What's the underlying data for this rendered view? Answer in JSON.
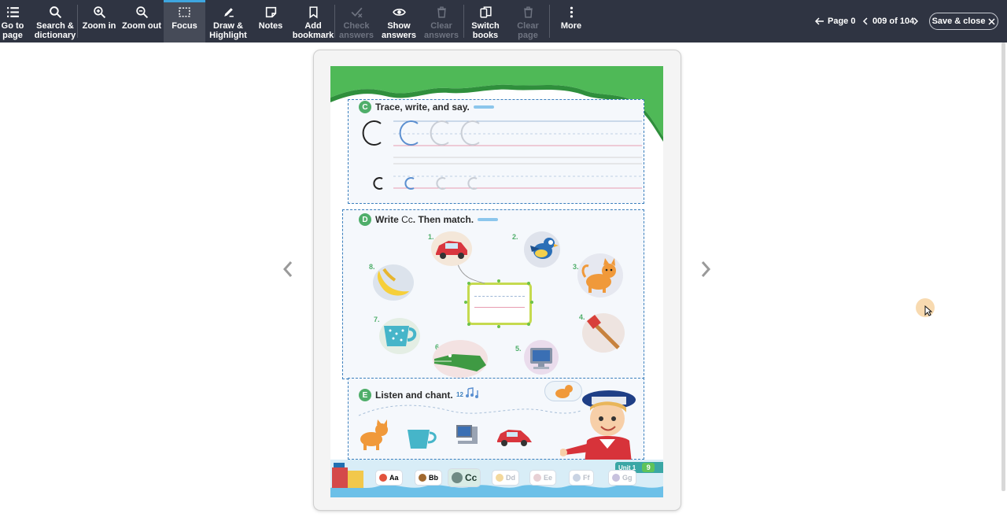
{
  "toolbar": {
    "buttons": [
      {
        "label": "Go to\npage",
        "icon": "toc-icon",
        "disabled": false
      },
      {
        "label": "Search &\ndictionary",
        "icon": "search-icon",
        "disabled": false
      },
      {
        "label": "Zoom in",
        "icon": "zoom-in-icon",
        "disabled": false
      },
      {
        "label": "Zoom out",
        "icon": "zoom-out-icon",
        "disabled": false
      },
      {
        "label": "Focus",
        "icon": "focus-icon",
        "disabled": false,
        "active": true
      },
      {
        "label": "Draw &\nHighlight",
        "icon": "pen-icon",
        "disabled": false
      },
      {
        "label": "Notes",
        "icon": "note-icon",
        "disabled": false
      },
      {
        "label": "Add\nbookmark",
        "icon": "bookmark-icon",
        "disabled": false
      },
      {
        "label": "Check\nanswers",
        "icon": "check-icon",
        "disabled": true
      },
      {
        "label": "Show\nanswers",
        "icon": "eye-icon",
        "disabled": false
      },
      {
        "label": "Clear\nanswers",
        "icon": "trash-icon",
        "disabled": true
      },
      {
        "label": "Switch\nbooks",
        "icon": "books-icon",
        "disabled": false
      },
      {
        "label": "Clear\npage",
        "icon": "trash-icon",
        "disabled": true
      },
      {
        "label": "More",
        "icon": "more-icon",
        "disabled": false
      }
    ],
    "page_label": "Page 0",
    "page_counter": "009 of 104",
    "save_close": "Save & close"
  },
  "book": {
    "section_c": {
      "letter": "C",
      "title": "Trace, write, and say."
    },
    "section_d": {
      "letter": "D",
      "title_prefix": "Write ",
      "title_cc": "Cc",
      "title_suffix": ". Then match."
    },
    "section_e": {
      "letter": "E",
      "title": "Listen and chant.",
      "track": "12"
    },
    "item_numbers": [
      "1.",
      "2.",
      "3.",
      "4.",
      "5.",
      "6.",
      "7.",
      "8."
    ],
    "unit_label": "Unit 1",
    "page_number": "9",
    "alphabet": [
      "Aa",
      "Bb",
      "Cc",
      "Dd",
      "Ee",
      "Ff",
      "Gg"
    ],
    "current_letter": "Cc"
  },
  "colors": {
    "toolbar_bg": "#2f3442",
    "accent": "#3ea6e0",
    "section_green": "#4fae6a",
    "dashed_border": "#3b7fbd"
  }
}
